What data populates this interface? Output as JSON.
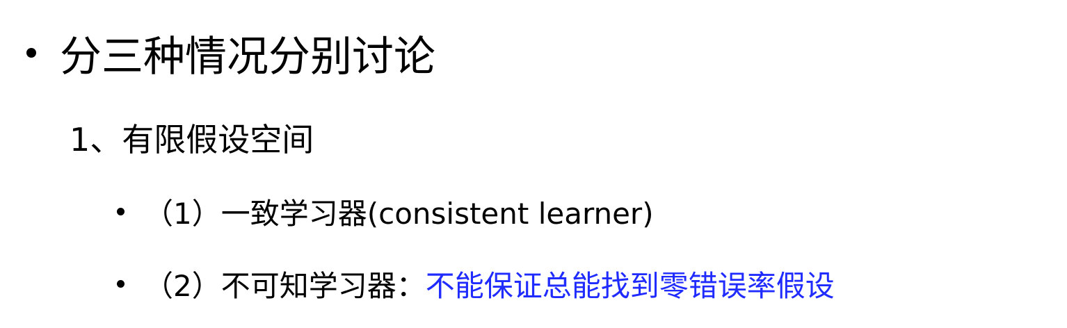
{
  "slide": {
    "heading": "分三种情况分别讨论",
    "subheading": "1、有限假设空间",
    "items": [
      {
        "label": "（1）一致学习器(consistent learner)"
      },
      {
        "label": "（2）不可知学习器：",
        "highlight": "不能保证总能找到零错误率假设"
      }
    ]
  },
  "colors": {
    "text": "#000000",
    "accent": "#1f2bff"
  }
}
